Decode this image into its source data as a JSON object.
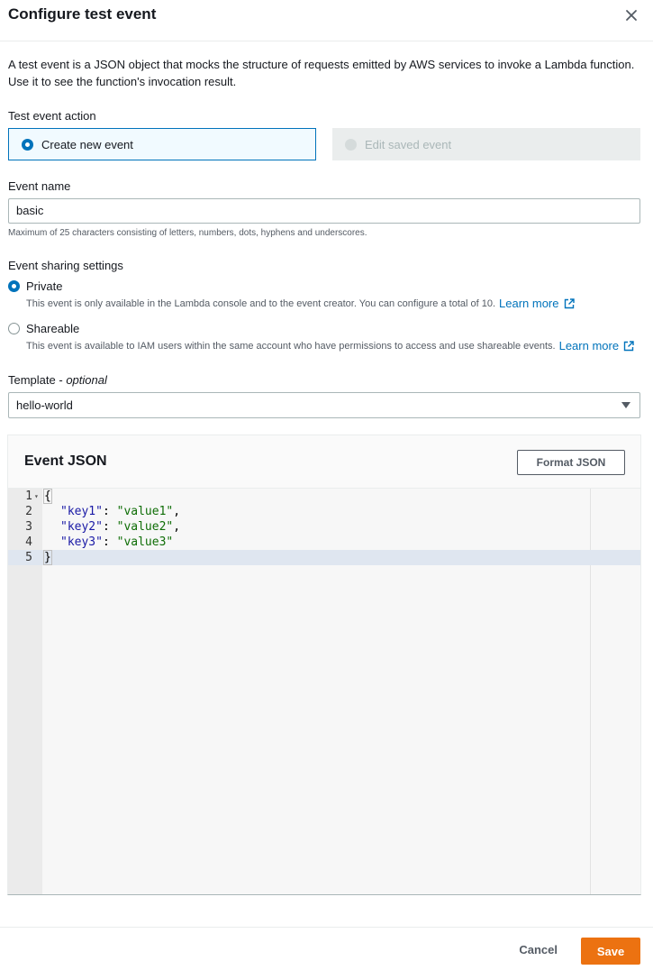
{
  "header": {
    "title": "Configure test event"
  },
  "description": "A test event is a JSON object that mocks the structure of requests emitted by AWS services to invoke a Lambda function. Use it to see the function's invocation result.",
  "test_event_action": {
    "label": "Test event action",
    "options": [
      {
        "label": "Create new event",
        "selected": true
      },
      {
        "label": "Edit saved event",
        "disabled": true
      }
    ]
  },
  "event_name": {
    "label": "Event name",
    "value": "basic",
    "hint": "Maximum of 25 characters consisting of letters, numbers, dots, hyphens and underscores."
  },
  "sharing": {
    "label": "Event sharing settings",
    "options": [
      {
        "label": "Private",
        "selected": true,
        "description": "This event is only available in the Lambda console and to the event creator. You can configure a total of 10.",
        "link": "Learn more"
      },
      {
        "label": "Shareable",
        "selected": false,
        "description": "This event is available to IAM users within the same account who have permissions to access and use shareable events.",
        "link": "Learn more"
      }
    ]
  },
  "template": {
    "label": "Template",
    "label_suffix": "optional",
    "label_separator": " - ",
    "value": "hello-world"
  },
  "editor": {
    "title": "Event JSON",
    "format_button": "Format JSON",
    "lines": [
      {
        "num": "1",
        "text": "{"
      },
      {
        "num": "2",
        "key": "\"key1\"",
        "sep": ": ",
        "value": "\"value1\"",
        "trail": ","
      },
      {
        "num": "3",
        "key": "\"key2\"",
        "sep": ": ",
        "value": "\"value2\"",
        "trail": ","
      },
      {
        "num": "4",
        "key": "\"key3\"",
        "sep": ": ",
        "value": "\"value3\"",
        "trail": ""
      },
      {
        "num": "5",
        "text": "}"
      }
    ]
  },
  "footer": {
    "cancel": "Cancel",
    "save": "Save"
  },
  "colors": {
    "accent": "#0073bb",
    "primary_button": "#ec7211",
    "json_key": "#1a1aa6",
    "json_string": "#0e6d06"
  },
  "icons": {
    "close": "close-icon",
    "external_link": "external-link-icon",
    "dropdown": "caret-down-icon",
    "fold": "fold-arrow-icon"
  }
}
